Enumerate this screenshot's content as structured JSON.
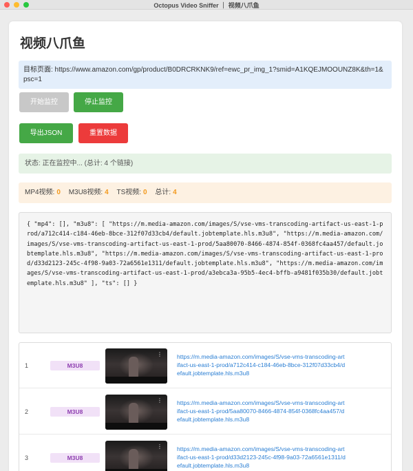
{
  "window": {
    "title": "Octopus Video Sniffer ｜ 视频八爪鱼"
  },
  "page": {
    "title": "视频八爪鱼",
    "target": "目标页面: https://www.amazon.com/gp/product/B0DRCRKNK9/ref=ewc_pr_img_1?smid=A1KQEJMOOUNZ8K&th=1&psc=1"
  },
  "buttons": {
    "start": "开始监控",
    "stop": "停止监控",
    "export": "导出JSON",
    "reset": "重置数据"
  },
  "colors": {
    "start_disabled": "#c8c8c8",
    "stop": "#45a846",
    "export": "#45a846",
    "reset": "#ec3b3b",
    "count_accent": "#f39a1e",
    "link": "#2a7ed3"
  },
  "status": {
    "text": "状态: 正在监控中... (总计: 4 个链接)"
  },
  "counts": {
    "mp4_label": "MP4视频:",
    "mp4": "0",
    "m3u8_label": "M3U8视频:",
    "m3u8": "4",
    "ts_label": "TS视频:",
    "ts": "0",
    "total_label": "总计:",
    "total": "4"
  },
  "json_output": "{ \"mp4\": [], \"m3u8\": [ \"https://m.media-amazon.com/images/S/vse-vms-transcoding-artifact-us-east-1-prod/a712c414-c184-46eb-8bce-312f07d33cb4/default.jobtemplate.hls.m3u8\", \"https://m.media-amazon.com/images/S/vse-vms-transcoding-artifact-us-east-1-prod/5aa80070-8466-4874-854f-0368fc4aa457/default.jobtemplate.hls.m3u8\", \"https://m.media-amazon.com/images/S/vse-vms-transcoding-artifact-us-east-1-prod/d33d2123-245c-4f98-9a03-72a6561e1311/default.jobtemplate.hls.m3u8\", \"https://m.media-amazon.com/images/S/vse-vms-transcoding-artifact-us-east-1-prod/a3ebca3a-95b5-4ec4-bffb-a9481f035b30/default.jobtemplate.hls.m3u8\" ], \"ts\": [] }",
  "list": [
    {
      "index": "1",
      "type": "M3U8",
      "thumb_icon": "video-thumbnail",
      "menu": "⋮",
      "url": "https://m.media-amazon.com/images/S/vse-vms-transcoding-artifact-us-east-1-prod/a712c414-c184-46eb-8bce-312f07d33cb4/default.jobtemplate.hls.m3u8"
    },
    {
      "index": "2",
      "type": "M3U8",
      "thumb_icon": "video-thumbnail",
      "menu": "⋮",
      "url": "https://m.media-amazon.com/images/S/vse-vms-transcoding-artifact-us-east-1-prod/5aa80070-8466-4874-854f-0368fc4aa457/default.jobtemplate.hls.m3u8"
    },
    {
      "index": "3",
      "type": "M3U8",
      "thumb_icon": "video-thumbnail",
      "menu": "⋮",
      "url": "https://m.media-amazon.com/images/S/vse-vms-transcoding-artifact-us-east-1-prod/d33d2123-245c-4f98-9a03-72a6561e1311/default.jobtemplate.hls.m3u8"
    }
  ]
}
